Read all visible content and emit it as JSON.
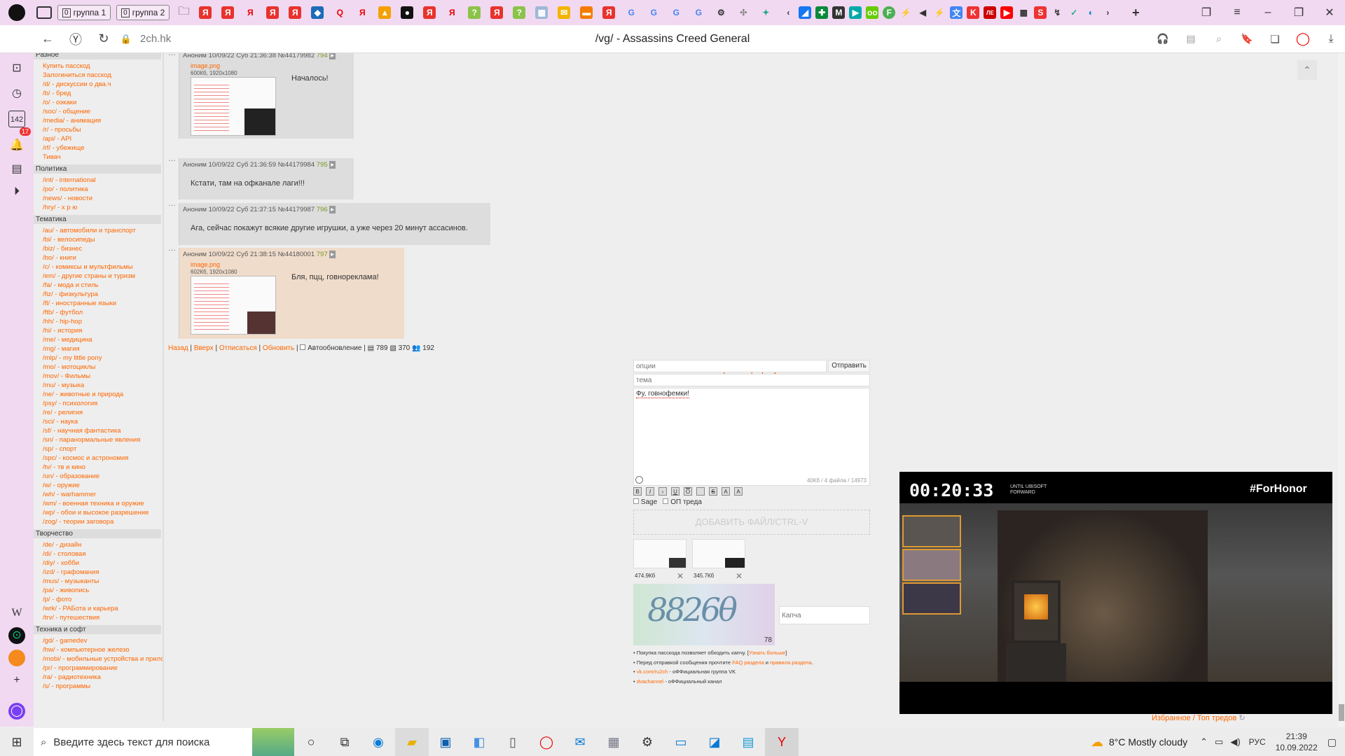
{
  "tabs": [
    {
      "count": "0",
      "label": "группа 1"
    },
    {
      "count": "0",
      "label": "группа 2"
    }
  ],
  "address": {
    "domain": "2ch.hk",
    "page_title": "/vg/ - Assassins Creed General"
  },
  "browser_sidebar": {
    "notifications_count": "17",
    "box_count": "142"
  },
  "board_nav": {
    "sections": [
      {
        "title": "Разное",
        "links": [
          "Купить пасскод",
          "Залогиниться пасскод",
          "/d/ - дискуссии о два.ч",
          "/b/ - бред",
          "/o/ - оэкаки",
          "/soc/ - общение",
          "/media/ - анимация",
          "/r/ - просьбы",
          "/api/ - API",
          "/rf/ - убежище",
          "Тивач"
        ]
      },
      {
        "title": "Политика",
        "links": [
          "/int/ - international",
          "/po/ - политика",
          "/news/ - новости",
          "/hry/ - х р ю"
        ]
      },
      {
        "title": "Тематика",
        "links": [
          "/au/ - автомобили и транспорт",
          "/bi/ - велосипеды",
          "/biz/ - бизнес",
          "/bo/ - книги",
          "/c/ - комиксы и мультфильмы",
          "/em/ - другие страны и туризм",
          "/fa/ - мода и стиль",
          "/fiz/ - физкультура",
          "/fl/ - иностранные языки",
          "/ftb/ - футбол",
          "/hh/ - hip-hop",
          "/hi/ - история",
          "/me/ - медицина",
          "/mg/ - магия",
          "/mlp/ - my little pony",
          "/mo/ - мотоциклы",
          "/mov/ - Фильмы",
          "/mu/ - музыка",
          "/ne/ - животные и природа",
          "/psy/ - психология",
          "/re/ - религия",
          "/sci/ - наука",
          "/sf/ - научная фантастика",
          "/sn/ - паранормальные явления",
          "/sp/ - спорт",
          "/spc/ - космос и астрономия",
          "/tv/ - тв и кино",
          "/un/ - образование",
          "/w/ - оружие",
          "/wh/ - warhammer",
          "/wm/ - военная техника и оружие",
          "/wp/ - обои и высокое разрешение",
          "/zog/ - теории заговора"
        ]
      },
      {
        "title": "Творчество",
        "links": [
          "/de/ - дизайн",
          "/di/ - столовая",
          "/diy/ - хобби",
          "/izd/ - графомания",
          "/mus/ - музыканты",
          "/pa/ - живопись",
          "/p/ - фото",
          "/wrk/ - РАБота и карьера",
          "/trv/ - путешествия"
        ]
      },
      {
        "title": "Техника и софт",
        "links": [
          "/gd/ - gamedev",
          "/hw/ - компьютерное железо",
          "/mobi/ - мобильные устройства и приложения",
          "/pr/ - программирование",
          "/ra/ - радиотехника",
          "/s/ - программы"
        ]
      }
    ]
  },
  "posts": [
    {
      "author": "Аноним",
      "datetime": "10/09/22 Суб 21:36:38",
      "id": "№44179982",
      "index": "794",
      "file": "image.png",
      "file_meta": "600Кб, 1920x1080",
      "text": "Началось!"
    },
    {
      "author": "Аноним",
      "datetime": "10/09/22 Суб 21:36:59",
      "id": "№44179984",
      "index": "795",
      "text": "Кстати, там на офканале лаги!!!"
    },
    {
      "author": "Аноним",
      "datetime": "10/09/22 Суб 21:37:15",
      "id": "№44179987",
      "index": "796",
      "text": "Ага, сейчас покажут всякие другие игрушки, а уже через 20 минут ассасинов."
    },
    {
      "author": "Аноним",
      "datetime": "10/09/22 Суб 21:38:15",
      "id": "№44180001",
      "index": "797",
      "file": "image.png",
      "file_meta": "602Кб, 1920x1080",
      "text": "Бля, пцц, говнореклама!"
    }
  ],
  "thread_nav": {
    "back": "Назад",
    "up": "Вверх",
    "unsubscribe": "Отписаться",
    "refresh": "Обновить",
    "autorefresh": "Автообновление",
    "posts_count": "789",
    "files_count": "370",
    "posters_count": "192"
  },
  "form": {
    "close_label": "Закрыть форму постинга",
    "options_placeholder": "опции",
    "submit_label": "Отправить",
    "subject_placeholder": "тема",
    "message_value": "Фу, говнофемки!",
    "limits": "40Кб / 4 файла / 14973",
    "format_buttons": [
      "B",
      "I",
      "›",
      "U",
      "O",
      "",
      "S",
      "A",
      "A"
    ],
    "sage_label": "Sage",
    "op_label": "ОП треда",
    "add_file_label": "ДОБАВИТЬ ФАЙЛ/CTRL-V",
    "attachments": [
      {
        "size": "474.9Кб"
      },
      {
        "size": "345.7Кб"
      }
    ],
    "captcha_placeholder": "Капча",
    "captcha_count": "78",
    "notes": [
      "Покупка пасскода позволяет обходить капчу.",
      "Узнать больше",
      "Перед отправкой сообщения прочтите",
      "FAQ раздела",
      "и",
      "правила раздела",
      "vk.com/ru2ch",
      "- оФФициальная группа VK",
      "dvachannel",
      "- оФФициальный канал"
    ]
  },
  "video": {
    "timer": "00:20:33",
    "timer_note": "UNTIL UBISOFT FORWARD",
    "hashtag": "#ForHonor"
  },
  "favorites_label": "Избранное / Топ тредов",
  "taskbar": {
    "search_placeholder": "Введите здесь текст для поиска",
    "weather": "8°C  Mostly cloudy",
    "lang": "РУС",
    "time": "21:39",
    "date": "10.09.2022"
  },
  "colors": {
    "accent": "#ff6600",
    "post_highlight": "#f0dccb",
    "tabbar": "#f1d9f1"
  }
}
